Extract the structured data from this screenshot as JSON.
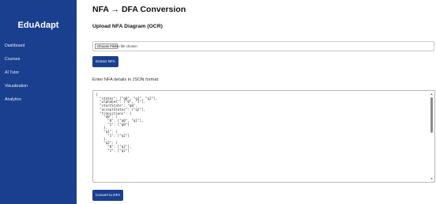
{
  "app": {
    "brand": "EduAdapt"
  },
  "sidebar": {
    "items": [
      {
        "label": "Dashboard"
      },
      {
        "label": "Courses"
      },
      {
        "label": "AI Tutor"
      },
      {
        "label": "Visualization"
      },
      {
        "label": "Analytics"
      }
    ]
  },
  "main": {
    "title": "NFA → DFA Conversion",
    "upload_heading": "Upload NFA Diagram (OCR)",
    "file_button": "Choose File",
    "file_status": "No file chosen",
    "extract_button": "Extract NFA",
    "json_label": "Enter NFA details in JSON format:",
    "json_text": "{\n  \"states\": [\"q0\", \"q1\", \"q2\"],\n  \"alphabet\": [\"0\", \"1\"],\n  \"startState\": \"q0\",\n  \"acceptStates\": [\"q2\"],\n  \"transitions\": {\n    \"q0\": {\n      \"0\": [\"q0\", \"q1\"],\n      \"1\": [\"q0\"]\n    },\n    \"q1\": {\n      \"1\": [\"q2\"]\n    },\n    \"q2\": {\n      \"0\": [\"q2\"],\n      \"1\": [\"q2\"]",
    "convert_button": "Convert to DFA"
  },
  "colors": {
    "primary": "#1b3f8f",
    "background": "#ffffff"
  }
}
